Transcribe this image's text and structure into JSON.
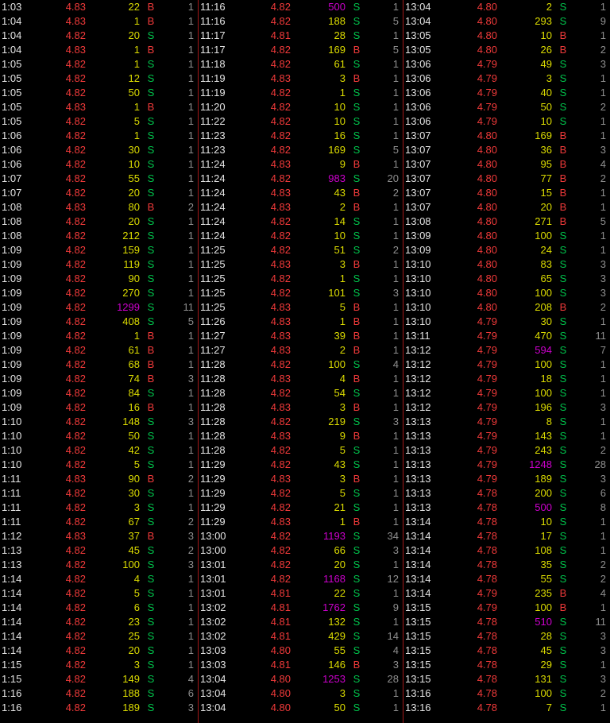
{
  "app": {
    "title": "time-and-sales-tape",
    "background": "#000000"
  },
  "colors": {
    "time": "#e4e4e4",
    "price": "#f13a3a",
    "size": "#dcdc00",
    "size_block": "#cc00cc",
    "buy": "#f13a3a",
    "sell": "#00c24b",
    "count": "#8f8f8f",
    "separator": "#a01818"
  },
  "columns": [
    "time",
    "price",
    "size",
    "side",
    "count"
  ],
  "size_block_highlight_min": 500,
  "panels": [
    {
      "name": "tape-panel-left",
      "rows": [
        [
          "1:03",
          "4.83",
          "22",
          "B",
          "1"
        ],
        [
          "1:04",
          "4.83",
          "1",
          "B",
          "1"
        ],
        [
          "1:04",
          "4.82",
          "20",
          "S",
          "1"
        ],
        [
          "1:04",
          "4.83",
          "1",
          "B",
          "1"
        ],
        [
          "1:05",
          "4.82",
          "1",
          "S",
          "1"
        ],
        [
          "1:05",
          "4.82",
          "12",
          "S",
          "1"
        ],
        [
          "1:05",
          "4.82",
          "50",
          "S",
          "1"
        ],
        [
          "1:05",
          "4.83",
          "1",
          "B",
          "1"
        ],
        [
          "1:05",
          "4.82",
          "5",
          "S",
          "1"
        ],
        [
          "1:06",
          "4.82",
          "1",
          "S",
          "1"
        ],
        [
          "1:06",
          "4.82",
          "30",
          "S",
          "1"
        ],
        [
          "1:06",
          "4.82",
          "10",
          "S",
          "1"
        ],
        [
          "1:07",
          "4.82",
          "55",
          "S",
          "1"
        ],
        [
          "1:07",
          "4.82",
          "20",
          "S",
          "1"
        ],
        [
          "1:08",
          "4.83",
          "80",
          "B",
          "2"
        ],
        [
          "1:08",
          "4.82",
          "20",
          "S",
          "1"
        ],
        [
          "1:08",
          "4.82",
          "212",
          "S",
          "1"
        ],
        [
          "1:09",
          "4.82",
          "159",
          "S",
          "1"
        ],
        [
          "1:09",
          "4.82",
          "119",
          "S",
          "1"
        ],
        [
          "1:09",
          "4.82",
          "90",
          "S",
          "1"
        ],
        [
          "1:09",
          "4.82",
          "270",
          "S",
          "1"
        ],
        [
          "1:09",
          "4.82",
          "1299",
          "S",
          "11"
        ],
        [
          "1:09",
          "4.82",
          "408",
          "S",
          "5"
        ],
        [
          "1:09",
          "4.82",
          "1",
          "B",
          "1"
        ],
        [
          "1:09",
          "4.82",
          "61",
          "B",
          "1"
        ],
        [
          "1:09",
          "4.82",
          "68",
          "B",
          "1"
        ],
        [
          "1:09",
          "4.82",
          "74",
          "B",
          "3"
        ],
        [
          "1:09",
          "4.82",
          "84",
          "S",
          "1"
        ],
        [
          "1:09",
          "4.82",
          "16",
          "B",
          "1"
        ],
        [
          "1:10",
          "4.82",
          "148",
          "S",
          "3"
        ],
        [
          "1:10",
          "4.82",
          "50",
          "S",
          "1"
        ],
        [
          "1:10",
          "4.82",
          "42",
          "S",
          "1"
        ],
        [
          "1:10",
          "4.82",
          "5",
          "S",
          "1"
        ],
        [
          "1:11",
          "4.83",
          "90",
          "B",
          "2"
        ],
        [
          "1:11",
          "4.82",
          "30",
          "S",
          "1"
        ],
        [
          "1:11",
          "4.82",
          "3",
          "S",
          "1"
        ],
        [
          "1:11",
          "4.82",
          "67",
          "S",
          "2"
        ],
        [
          "1:12",
          "4.83",
          "37",
          "B",
          "3"
        ],
        [
          "1:13",
          "4.82",
          "45",
          "S",
          "2"
        ],
        [
          "1:13",
          "4.82",
          "100",
          "S",
          "3"
        ],
        [
          "1:14",
          "4.82",
          "4",
          "S",
          "1"
        ],
        [
          "1:14",
          "4.82",
          "5",
          "S",
          "1"
        ],
        [
          "1:14",
          "4.82",
          "6",
          "S",
          "1"
        ],
        [
          "1:14",
          "4.82",
          "23",
          "S",
          "1"
        ],
        [
          "1:14",
          "4.82",
          "25",
          "S",
          "1"
        ],
        [
          "1:14",
          "4.82",
          "20",
          "S",
          "1"
        ],
        [
          "1:15",
          "4.82",
          "3",
          "S",
          "1"
        ],
        [
          "1:15",
          "4.82",
          "149",
          "S",
          "4"
        ],
        [
          "1:16",
          "4.82",
          "188",
          "S",
          "6"
        ],
        [
          "1:16",
          "4.82",
          "189",
          "S",
          "3"
        ]
      ]
    },
    {
      "name": "tape-panel-middle",
      "rows": [
        [
          "11:16",
          "4.82",
          "500",
          "S",
          "1"
        ],
        [
          "11:16",
          "4.82",
          "188",
          "S",
          "5"
        ],
        [
          "11:17",
          "4.81",
          "28",
          "S",
          "1"
        ],
        [
          "11:17",
          "4.82",
          "169",
          "B",
          "5"
        ],
        [
          "11:18",
          "4.82",
          "61",
          "S",
          "1"
        ],
        [
          "11:19",
          "4.83",
          "3",
          "B",
          "1"
        ],
        [
          "11:19",
          "4.82",
          "1",
          "S",
          "1"
        ],
        [
          "11:20",
          "4.82",
          "10",
          "S",
          "1"
        ],
        [
          "11:22",
          "4.82",
          "10",
          "S",
          "1"
        ],
        [
          "11:23",
          "4.82",
          "16",
          "S",
          "1"
        ],
        [
          "11:23",
          "4.82",
          "169",
          "S",
          "5"
        ],
        [
          "11:24",
          "4.83",
          "9",
          "B",
          "1"
        ],
        [
          "11:24",
          "4.82",
          "983",
          "S",
          "20"
        ],
        [
          "11:24",
          "4.83",
          "43",
          "B",
          "2"
        ],
        [
          "11:24",
          "4.83",
          "2",
          "B",
          "1"
        ],
        [
          "11:24",
          "4.82",
          "14",
          "S",
          "1"
        ],
        [
          "11:24",
          "4.82",
          "10",
          "S",
          "1"
        ],
        [
          "11:25",
          "4.82",
          "51",
          "S",
          "2"
        ],
        [
          "11:25",
          "4.83",
          "3",
          "B",
          "1"
        ],
        [
          "11:25",
          "4.82",
          "1",
          "S",
          "1"
        ],
        [
          "11:25",
          "4.82",
          "101",
          "S",
          "3"
        ],
        [
          "11:25",
          "4.83",
          "5",
          "B",
          "1"
        ],
        [
          "11:26",
          "4.83",
          "1",
          "B",
          "1"
        ],
        [
          "11:27",
          "4.83",
          "39",
          "B",
          "1"
        ],
        [
          "11:27",
          "4.83",
          "2",
          "B",
          "1"
        ],
        [
          "11:28",
          "4.82",
          "100",
          "S",
          "4"
        ],
        [
          "11:28",
          "4.83",
          "4",
          "B",
          "1"
        ],
        [
          "11:28",
          "4.82",
          "54",
          "S",
          "1"
        ],
        [
          "11:28",
          "4.83",
          "3",
          "B",
          "1"
        ],
        [
          "11:28",
          "4.82",
          "219",
          "S",
          "3"
        ],
        [
          "11:28",
          "4.83",
          "9",
          "B",
          "1"
        ],
        [
          "11:28",
          "4.82",
          "5",
          "S",
          "1"
        ],
        [
          "11:29",
          "4.82",
          "43",
          "S",
          "1"
        ],
        [
          "11:29",
          "4.83",
          "3",
          "B",
          "1"
        ],
        [
          "11:29",
          "4.82",
          "5",
          "S",
          "1"
        ],
        [
          "11:29",
          "4.82",
          "21",
          "S",
          "1"
        ],
        [
          "11:29",
          "4.83",
          "1",
          "B",
          "1"
        ],
        [
          "13:00",
          "4.82",
          "1193",
          "S",
          "34"
        ],
        [
          "13:00",
          "4.82",
          "66",
          "S",
          "3"
        ],
        [
          "13:01",
          "4.82",
          "20",
          "S",
          "1"
        ],
        [
          "13:01",
          "4.82",
          "1168",
          "S",
          "12"
        ],
        [
          "13:01",
          "4.81",
          "22",
          "S",
          "1"
        ],
        [
          "13:02",
          "4.81",
          "1762",
          "S",
          "9"
        ],
        [
          "13:02",
          "4.81",
          "132",
          "S",
          "1"
        ],
        [
          "13:02",
          "4.81",
          "429",
          "S",
          "14"
        ],
        [
          "13:03",
          "4.80",
          "55",
          "S",
          "4"
        ],
        [
          "13:03",
          "4.81",
          "146",
          "B",
          "3"
        ],
        [
          "13:04",
          "4.80",
          "1253",
          "S",
          "28"
        ],
        [
          "13:04",
          "4.80",
          "3",
          "S",
          "1"
        ],
        [
          "13:04",
          "4.80",
          "50",
          "S",
          "1"
        ]
      ]
    },
    {
      "name": "tape-panel-right",
      "rows": [
        [
          "13:04",
          "4.80",
          "2",
          "S",
          "1"
        ],
        [
          "13:04",
          "4.80",
          "293",
          "S",
          "9"
        ],
        [
          "13:05",
          "4.80",
          "10",
          "B",
          "1"
        ],
        [
          "13:05",
          "4.80",
          "26",
          "B",
          "2"
        ],
        [
          "13:06",
          "4.79",
          "49",
          "S",
          "3"
        ],
        [
          "13:06",
          "4.79",
          "3",
          "S",
          "1"
        ],
        [
          "13:06",
          "4.79",
          "40",
          "S",
          "1"
        ],
        [
          "13:06",
          "4.79",
          "50",
          "S",
          "2"
        ],
        [
          "13:06",
          "4.79",
          "10",
          "S",
          "1"
        ],
        [
          "13:07",
          "4.80",
          "169",
          "B",
          "1"
        ],
        [
          "13:07",
          "4.80",
          "36",
          "B",
          "3"
        ],
        [
          "13:07",
          "4.80",
          "95",
          "B",
          "4"
        ],
        [
          "13:07",
          "4.80",
          "77",
          "B",
          "2"
        ],
        [
          "13:07",
          "4.80",
          "15",
          "B",
          "1"
        ],
        [
          "13:07",
          "4.80",
          "20",
          "B",
          "1"
        ],
        [
          "13:08",
          "4.80",
          "271",
          "B",
          "5"
        ],
        [
          "13:09",
          "4.80",
          "100",
          "S",
          "1"
        ],
        [
          "13:09",
          "4.80",
          "24",
          "S",
          "1"
        ],
        [
          "13:10",
          "4.80",
          "83",
          "S",
          "3"
        ],
        [
          "13:10",
          "4.80",
          "65",
          "S",
          "3"
        ],
        [
          "13:10",
          "4.80",
          "100",
          "S",
          "3"
        ],
        [
          "13:10",
          "4.80",
          "208",
          "B",
          "2"
        ],
        [
          "13:10",
          "4.79",
          "30",
          "S",
          "1"
        ],
        [
          "13:11",
          "4.79",
          "470",
          "S",
          "11"
        ],
        [
          "13:12",
          "4.79",
          "594",
          "S",
          "7"
        ],
        [
          "13:12",
          "4.79",
          "100",
          "S",
          "1"
        ],
        [
          "13:12",
          "4.79",
          "18",
          "S",
          "1"
        ],
        [
          "13:12",
          "4.79",
          "100",
          "S",
          "1"
        ],
        [
          "13:12",
          "4.79",
          "196",
          "S",
          "3"
        ],
        [
          "13:13",
          "4.79",
          "8",
          "S",
          "1"
        ],
        [
          "13:13",
          "4.79",
          "143",
          "S",
          "1"
        ],
        [
          "13:13",
          "4.79",
          "243",
          "S",
          "2"
        ],
        [
          "13:13",
          "4.79",
          "1248",
          "S",
          "28"
        ],
        [
          "13:13",
          "4.79",
          "189",
          "S",
          "3"
        ],
        [
          "13:13",
          "4.78",
          "200",
          "S",
          "6"
        ],
        [
          "13:13",
          "4.78",
          "500",
          "S",
          "8"
        ],
        [
          "13:14",
          "4.78",
          "10",
          "S",
          "1"
        ],
        [
          "13:14",
          "4.78",
          "17",
          "S",
          "1"
        ],
        [
          "13:14",
          "4.78",
          "108",
          "S",
          "1"
        ],
        [
          "13:14",
          "4.78",
          "35",
          "S",
          "2"
        ],
        [
          "13:14",
          "4.78",
          "55",
          "S",
          "2"
        ],
        [
          "13:14",
          "4.79",
          "235",
          "B",
          "4"
        ],
        [
          "13:15",
          "4.79",
          "100",
          "B",
          "1"
        ],
        [
          "13:15",
          "4.78",
          "510",
          "S",
          "11"
        ],
        [
          "13:15",
          "4.78",
          "28",
          "S",
          "3"
        ],
        [
          "13:15",
          "4.78",
          "45",
          "S",
          "3"
        ],
        [
          "13:15",
          "4.78",
          "29",
          "S",
          "1"
        ],
        [
          "13:15",
          "4.78",
          "131",
          "S",
          "3"
        ],
        [
          "13:16",
          "4.78",
          "100",
          "S",
          "2"
        ],
        [
          "13:16",
          "4.78",
          "7",
          "S",
          "1"
        ]
      ]
    }
  ]
}
